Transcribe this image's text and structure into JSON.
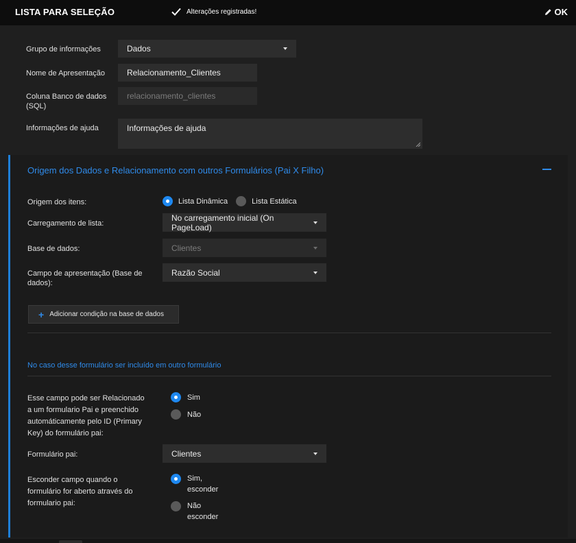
{
  "header": {
    "title": "LISTA PARA SELEÇÃO",
    "saved_message": "Alterações registradas!",
    "ok_label": "OK"
  },
  "form": {
    "group": {
      "label": "Grupo de informações",
      "value": "Dados"
    },
    "display_name": {
      "label": "Nome de Apresentação",
      "value": "Relacionamento_Clientes"
    },
    "db_column": {
      "label_line1": "Coluna Banco de dados",
      "label_line2": "(SQL)",
      "value": "relacionamento_clientes"
    },
    "help": {
      "label": "Informações de ajuda",
      "value": "Informações de ajuda"
    }
  },
  "section": {
    "title": "Origem dos Dados e Relacionamento com outros Formulários (Pai X Filho)",
    "origin": {
      "label": "Origem dos itens:",
      "option_dynamic": "Lista Dinâmica",
      "option_static": "Lista Estática",
      "selected": "dynamic"
    },
    "loading": {
      "label": "Carregamento de lista:",
      "value": "No carregamento inicial (On PageLoad)"
    },
    "database": {
      "label": "Base de dados:",
      "value": "Clientes"
    },
    "display_field": {
      "label_line1": "Campo de apresentação (Base de",
      "label_line2": "dados):",
      "value": "Razão Social"
    },
    "add_condition_label": "Adicionar condição na base de dados",
    "subsection_title": "No caso desse formulário ser incluído em outro formulário",
    "relate": {
      "label_line1": "Esse campo pode ser Relacionado",
      "label_line2": "a um formulario Pai e preenchido",
      "label_line3": "automáticamente pelo ID (Primary",
      "label_line4": "Key) do formulário pai:",
      "option_yes": "Sim",
      "option_no": "Não",
      "selected": "yes"
    },
    "parent_form": {
      "label": "Formulário pai:",
      "value": "Clientes"
    },
    "hide": {
      "label_line1": "Esconder campo quando o",
      "label_line2": "formulário for aberto através do",
      "label_line3": "formulario pai:",
      "option_yes_line1": "Sim,",
      "option_yes_line2": "esconder",
      "option_no_line1": "Não",
      "option_no_line2": "esconder",
      "selected": "yes"
    }
  },
  "colors": {
    "accent": "#2f8bea",
    "radio_on": "#1e88f0",
    "background": "#1f1f1f",
    "topbar": "#0d0d0d"
  },
  "icons": [
    "check-icon",
    "pencil-icon",
    "chevron-down-icon",
    "plus-icon",
    "minus-icon",
    "resize-grip-icon"
  ]
}
